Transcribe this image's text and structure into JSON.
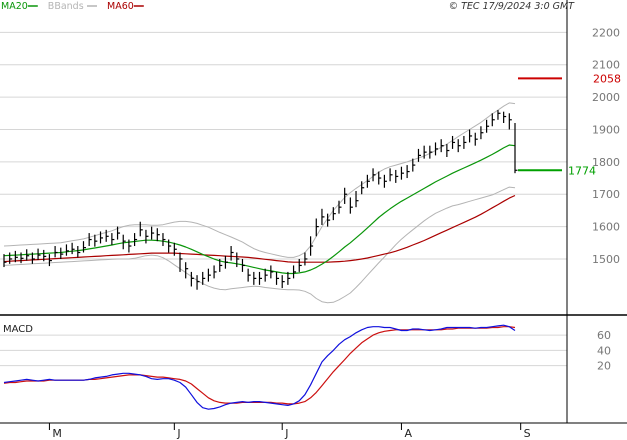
{
  "colors": {
    "ma20": "#0a960a",
    "bbands": "#b4b4b4",
    "ma60": "#aa0000",
    "macd": "#1010dd",
    "signal": "#cc1010",
    "price": "#000000",
    "grid": "#d6d6d6",
    "axis": "#000000",
    "label": "#777777",
    "resistance": "#cc0000",
    "last_price": "#00a000"
  },
  "legend": [
    {
      "id": "ma20",
      "label": "MA20",
      "color": "#0a960a"
    },
    {
      "id": "bbands",
      "label": "BBands",
      "color": "#b4b4b4"
    },
    {
      "id": "ma60",
      "label": "MA60",
      "color": "#aa0000"
    }
  ],
  "copyright": "© TEC 17/9/2024 3:0 GMT",
  "macd_label": "MACD",
  "chart_data": [
    {
      "type": "line",
      "title": "",
      "x_labels": [
        "M",
        "J",
        "J",
        "A",
        "S"
      ],
      "x_label_index": [
        8,
        30,
        49,
        70,
        91
      ],
      "y_ticks": [
        1500,
        1600,
        1700,
        1800,
        1900,
        2000,
        2100,
        2200
      ],
      "ylim": [
        1330,
        2300
      ],
      "grid": true,
      "annotations": [
        {
          "label": "2058",
          "value": 2058,
          "kind": "resistance"
        },
        {
          "label": "1774",
          "value": 1774,
          "kind": "last"
        }
      ],
      "price_bars": {
        "close": [
          1490,
          1500,
          1505,
          1502,
          1510,
          1500,
          1512,
          1508,
          1495,
          1520,
          1515,
          1525,
          1530,
          1520,
          1535,
          1560,
          1555,
          1565,
          1570,
          1560,
          1580,
          1555,
          1540,
          1560,
          1590,
          1570,
          1580,
          1575,
          1560,
          1540,
          1530,
          1500,
          1470,
          1440,
          1430,
          1440,
          1450,
          1460,
          1480,
          1490,
          1520,
          1500,
          1480,
          1450,
          1440,
          1440,
          1450,
          1460,
          1440,
          1430,
          1440,
          1460,
          1480,
          1500,
          1540,
          1600,
          1630,
          1620,
          1640,
          1660,
          1700,
          1660,
          1680,
          1720,
          1740,
          1760,
          1750,
          1740,
          1760,
          1755,
          1765,
          1770,
          1790,
          1820,
          1830,
          1830,
          1840,
          1850,
          1835,
          1860,
          1850,
          1860,
          1880,
          1870,
          1890,
          1910,
          1930,
          1950,
          1940,
          1930,
          1774
        ],
        "high": [
          1515,
          1520,
          1525,
          1520,
          1530,
          1520,
          1532,
          1528,
          1515,
          1540,
          1535,
          1545,
          1550,
          1540,
          1555,
          1580,
          1575,
          1585,
          1590,
          1580,
          1600,
          1575,
          1560,
          1580,
          1615,
          1590,
          1600,
          1595,
          1580,
          1560,
          1550,
          1520,
          1490,
          1460,
          1450,
          1460,
          1470,
          1480,
          1500,
          1510,
          1540,
          1520,
          1500,
          1470,
          1460,
          1460,
          1470,
          1480,
          1460,
          1450,
          1460,
          1480,
          1500,
          1520,
          1570,
          1625,
          1655,
          1640,
          1660,
          1680,
          1720,
          1690,
          1710,
          1740,
          1760,
          1780,
          1770,
          1760,
          1780,
          1775,
          1785,
          1790,
          1810,
          1840,
          1850,
          1850,
          1860,
          1870,
          1855,
          1880,
          1870,
          1880,
          1900,
          1890,
          1910,
          1930,
          1950,
          1960,
          1955,
          1950,
          1920
        ],
        "low": [
          1475,
          1485,
          1490,
          1487,
          1495,
          1485,
          1497,
          1493,
          1478,
          1505,
          1500,
          1510,
          1515,
          1505,
          1520,
          1540,
          1538,
          1548,
          1553,
          1543,
          1560,
          1530,
          1520,
          1540,
          1570,
          1548,
          1560,
          1555,
          1540,
          1520,
          1510,
          1460,
          1440,
          1415,
          1405,
          1420,
          1430,
          1440,
          1460,
          1470,
          1495,
          1475,
          1460,
          1430,
          1420,
          1420,
          1430,
          1440,
          1420,
          1410,
          1420,
          1440,
          1460,
          1480,
          1510,
          1570,
          1605,
          1600,
          1620,
          1640,
          1670,
          1640,
          1660,
          1700,
          1720,
          1740,
          1730,
          1720,
          1740,
          1735,
          1745,
          1750,
          1770,
          1800,
          1810,
          1810,
          1820,
          1830,
          1815,
          1840,
          1830,
          1840,
          1860,
          1850,
          1870,
          1890,
          1910,
          1930,
          1920,
          1900,
          1765
        ]
      },
      "series": [
        {
          "name": "MA20",
          "values": [
            1510,
            1511,
            1512,
            1513,
            1514,
            1515,
            1516,
            1517,
            1518,
            1519,
            1520,
            1522,
            1524,
            1526,
            1528,
            1531,
            1534,
            1537,
            1540,
            1543,
            1547,
            1550,
            1552,
            1554,
            1556,
            1558,
            1558,
            1557,
            1555,
            1552,
            1548,
            1543,
            1537,
            1530,
            1522,
            1514,
            1507,
            1500,
            1494,
            1490,
            1488,
            1485,
            1482,
            1478,
            1474,
            1470,
            1466,
            1463,
            1460,
            1457,
            1455,
            1455,
            1457,
            1460,
            1466,
            1474,
            1484,
            1495,
            1508,
            1522,
            1537,
            1550,
            1565,
            1580,
            1596,
            1612,
            1628,
            1642,
            1655,
            1667,
            1678,
            1688,
            1698,
            1708,
            1718,
            1728,
            1738,
            1747,
            1756,
            1765,
            1773,
            1781,
            1789,
            1797,
            1805,
            1814,
            1823,
            1833,
            1843,
            1852,
            1850
          ]
        },
        {
          "name": "MA60",
          "values": [
            1492,
            1493,
            1494,
            1495,
            1496,
            1497,
            1498,
            1499,
            1500,
            1501,
            1502,
            1503,
            1504,
            1505,
            1506,
            1507,
            1508,
            1509,
            1510,
            1511,
            1512,
            1513,
            1514,
            1515,
            1516,
            1517,
            1518,
            1518,
            1518,
            1518,
            1518,
            1517,
            1516,
            1515,
            1514,
            1513,
            1512,
            1511,
            1510,
            1509,
            1508,
            1507,
            1506,
            1505,
            1503,
            1501,
            1499,
            1497,
            1495,
            1493,
            1491,
            1490,
            1490,
            1490,
            1490,
            1490,
            1490,
            1490,
            1491,
            1492,
            1493,
            1495,
            1497,
            1500,
            1503,
            1507,
            1511,
            1515,
            1519,
            1524,
            1530,
            1536,
            1543,
            1550,
            1557,
            1565,
            1573,
            1581,
            1589,
            1597,
            1605,
            1613,
            1621,
            1629,
            1638,
            1648,
            1658,
            1668,
            1678,
            1688,
            1696
          ]
        },
        {
          "name": "BB Upper",
          "values": [
            1540,
            1541,
            1542,
            1543,
            1544,
            1545,
            1546,
            1547,
            1548,
            1549,
            1550,
            1553,
            1556,
            1559,
            1562,
            1567,
            1572,
            1577,
            1582,
            1587,
            1594,
            1600,
            1604,
            1606,
            1606,
            1606,
            1604,
            1604,
            1606,
            1610,
            1614,
            1616,
            1616,
            1614,
            1610,
            1604,
            1598,
            1590,
            1582,
            1575,
            1568,
            1560,
            1552,
            1542,
            1532,
            1525,
            1520,
            1516,
            1512,
            1508,
            1505,
            1505,
            1510,
            1520,
            1540,
            1570,
            1600,
            1625,
            1650,
            1670,
            1690,
            1705,
            1718,
            1730,
            1742,
            1755,
            1768,
            1778,
            1785,
            1790,
            1795,
            1800,
            1806,
            1812,
            1818,
            1826,
            1835,
            1845,
            1855,
            1866,
            1878,
            1889,
            1900,
            1911,
            1922,
            1935,
            1948,
            1960,
            1972,
            1982,
            1980
          ]
        },
        {
          "name": "BB Lower",
          "values": [
            1480,
            1481,
            1482,
            1483,
            1484,
            1485,
            1486,
            1487,
            1488,
            1489,
            1490,
            1491,
            1492,
            1493,
            1494,
            1495,
            1496,
            1497,
            1498,
            1499,
            1500,
            1500,
            1500,
            1502,
            1506,
            1510,
            1512,
            1510,
            1504,
            1494,
            1482,
            1470,
            1458,
            1446,
            1434,
            1424,
            1416,
            1410,
            1406,
            1405,
            1408,
            1410,
            1412,
            1414,
            1416,
            1415,
            1412,
            1410,
            1408,
            1406,
            1405,
            1405,
            1404,
            1400,
            1392,
            1378,
            1368,
            1365,
            1366,
            1374,
            1384,
            1395,
            1412,
            1430,
            1450,
            1469,
            1488,
            1506,
            1525,
            1544,
            1561,
            1576,
            1590,
            1604,
            1618,
            1630,
            1641,
            1649,
            1657,
            1664,
            1668,
            1673,
            1678,
            1683,
            1688,
            1693,
            1698,
            1706,
            1714,
            1722,
            1720
          ]
        }
      ]
    },
    {
      "type": "line",
      "title": "MACD",
      "y_ticks": [
        20,
        40,
        60
      ],
      "ylim": [
        -55,
        85
      ],
      "grid": true,
      "series": [
        {
          "name": "MACD",
          "values": [
            -2,
            -1,
            0,
            1,
            2,
            1,
            0,
            1,
            2,
            1,
            1,
            1,
            1,
            1,
            1,
            2,
            4,
            5,
            6,
            8,
            9,
            10,
            10,
            9,
            8,
            6,
            3,
            2,
            3,
            3,
            1,
            -2,
            -8,
            -18,
            -28,
            -35,
            -37,
            -36,
            -34,
            -31,
            -29,
            -28,
            -27,
            -28,
            -27,
            -27,
            -28,
            -29,
            -30,
            -31,
            -32,
            -30,
            -26,
            -18,
            -5,
            10,
            25,
            33,
            40,
            48,
            54,
            58,
            63,
            67,
            70,
            71,
            71,
            70,
            70,
            68,
            66,
            66,
            68,
            68,
            67,
            66,
            67,
            68,
            70,
            70,
            70,
            70,
            70,
            69,
            70,
            70,
            71,
            72,
            73,
            71,
            66
          ]
        },
        {
          "name": "Signal",
          "values": [
            -3,
            -2,
            -2,
            -1,
            0,
            0,
            0,
            0,
            1,
            1,
            1,
            1,
            1,
            1,
            1,
            2,
            2,
            3,
            4,
            5,
            6,
            7,
            8,
            8,
            8,
            7,
            6,
            5,
            5,
            4,
            3,
            2,
            0,
            -4,
            -10,
            -16,
            -22,
            -26,
            -28,
            -29,
            -29,
            -29,
            -28,
            -28,
            -28,
            -28,
            -28,
            -28,
            -29,
            -29,
            -30,
            -30,
            -29,
            -27,
            -22,
            -15,
            -6,
            3,
            12,
            20,
            28,
            36,
            43,
            50,
            55,
            60,
            63,
            65,
            66,
            67,
            67,
            67,
            67,
            67,
            67,
            67,
            67,
            67,
            68,
            68,
            69,
            69,
            69,
            69,
            69,
            69,
            70,
            70,
            71,
            71,
            70
          ]
        }
      ]
    }
  ]
}
